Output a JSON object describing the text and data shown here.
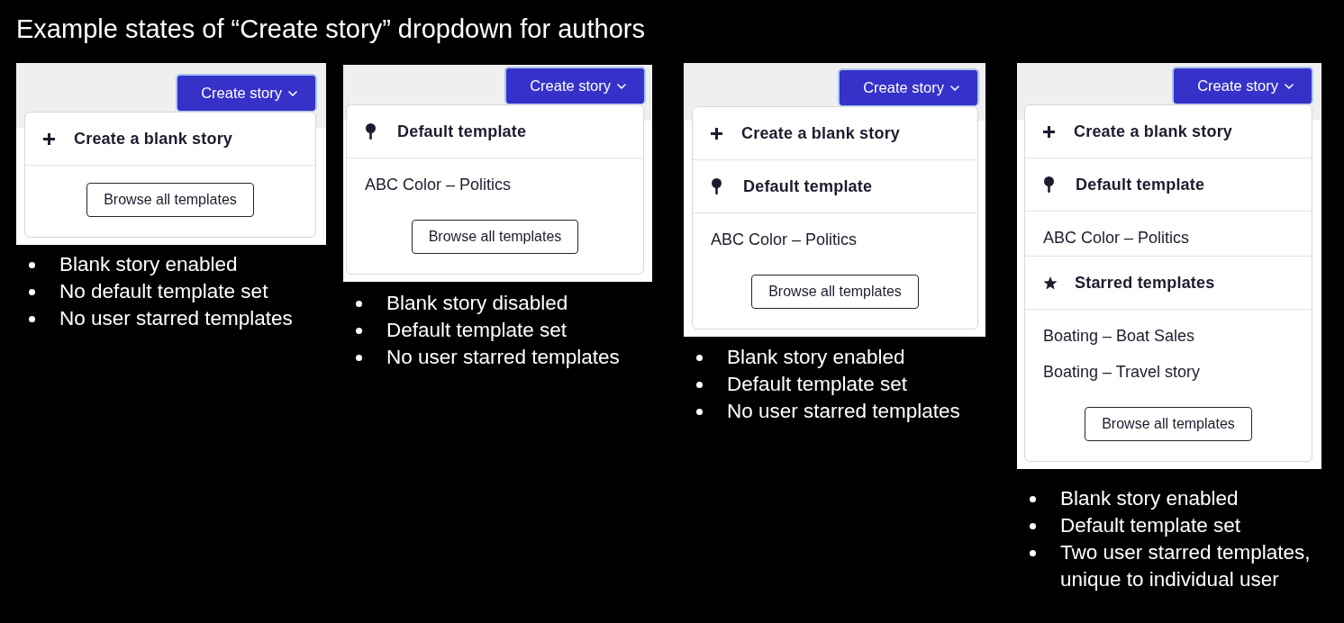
{
  "title": "Example states of “Create story” dropdown for authors",
  "examples": [
    {
      "dropdown": {
        "button": "Create story",
        "sections": [
          {
            "kind": "create_blank",
            "label": "Create a blank story"
          }
        ],
        "browse_button": "Browse all templates"
      },
      "notes": [
        "Blank story enabled",
        "No default template set",
        "No user starred templates"
      ]
    },
    {
      "dropdown": {
        "button": "Create story",
        "sections": [
          {
            "kind": "default_heading",
            "label": "Default template"
          },
          {
            "kind": "template_list",
            "items": [
              "ABC Color – Politics"
            ]
          }
        ],
        "browse_button": "Browse all templates"
      },
      "notes": [
        "Blank story disabled",
        "Default template set",
        "No user starred templates"
      ]
    },
    {
      "dropdown": {
        "button": "Create story",
        "sections": [
          {
            "kind": "create_blank",
            "label": "Create a blank story"
          },
          {
            "kind": "default_heading",
            "label": "Default template"
          },
          {
            "kind": "template_list",
            "items": [
              "ABC Color – Politics"
            ]
          }
        ],
        "browse_button": "Browse all templates"
      },
      "notes": [
        "Blank story enabled",
        "Default template set",
        "No user starred templates"
      ]
    },
    {
      "dropdown": {
        "button": "Create story",
        "sections": [
          {
            "kind": "create_blank",
            "label": "Create a blank story"
          },
          {
            "kind": "default_heading",
            "label": "Default template"
          },
          {
            "kind": "template_list",
            "items": [
              "ABC Color – Politics"
            ]
          },
          {
            "kind": "starred_heading",
            "label": "Starred templates"
          },
          {
            "kind": "template_list",
            "items": [
              "Boating – Boat Sales",
              "Boating – Travel story"
            ]
          }
        ],
        "browse_button": "Browse all templates"
      },
      "notes": [
        "Blank story enabled",
        "Default template set",
        "Two user starred templates, unique to individual user"
      ]
    }
  ]
}
